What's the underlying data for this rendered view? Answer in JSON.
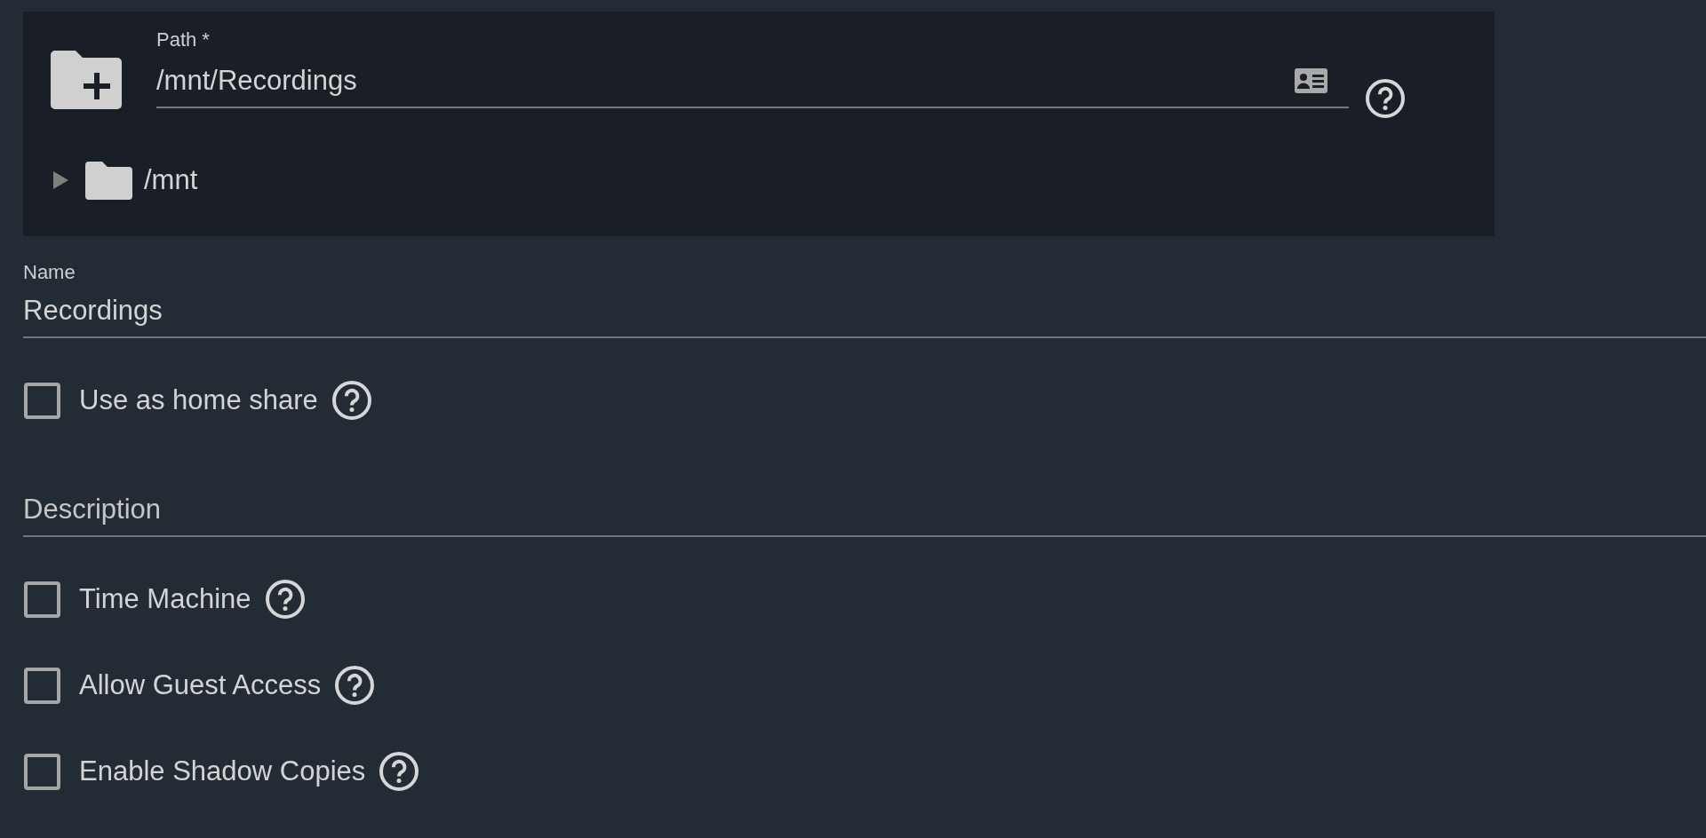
{
  "path_field": {
    "label": "Path *",
    "value": "/mnt/Recordings"
  },
  "tree": [
    {
      "label": "/mnt",
      "expanded": false
    }
  ],
  "form_items": [
    {
      "kind": "text_field",
      "label": "Name",
      "value": "Recordings"
    },
    {
      "kind": "checkbox",
      "label": "Use as home share",
      "checked": false
    },
    {
      "kind": "text_field",
      "placeholder": "Description"
    },
    {
      "kind": "checkbox",
      "label": "Time Machine",
      "checked": false
    },
    {
      "kind": "checkbox",
      "label": "Allow Guest Access",
      "checked": false
    },
    {
      "kind": "checkbox",
      "label": "Enable Shadow Copies",
      "checked": false
    }
  ]
}
